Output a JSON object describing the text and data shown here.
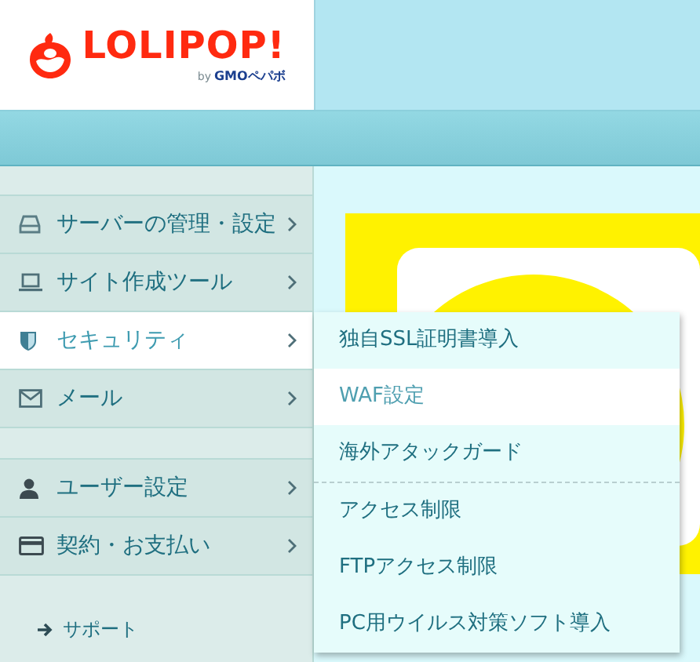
{
  "logo": {
    "wordmark": "LOLIPOP!",
    "byline_prefix": "by",
    "byline_brand": "GMOペパボ"
  },
  "sidebar": {
    "groups": [
      [
        {
          "label": "サーバーの管理・設定",
          "kind": "drive",
          "selected": false
        },
        {
          "label": "サイト作成ツール",
          "kind": "laptop",
          "selected": false
        },
        {
          "label": "セキュリティ",
          "kind": "shield",
          "selected": true
        },
        {
          "label": "メール",
          "kind": "envelope",
          "selected": false
        }
      ],
      [
        {
          "label": "ユーザー設定",
          "kind": "user",
          "selected": false
        },
        {
          "label": "契約・お支払い",
          "kind": "card",
          "selected": false
        }
      ]
    ],
    "support_link": "サポート"
  },
  "submenu": {
    "groups": [
      [
        {
          "label": "独自SSL証明書導入",
          "selected": false
        },
        {
          "label": "WAF設定",
          "selected": true
        },
        {
          "label": "海外アタックガード",
          "selected": false
        }
      ],
      [
        {
          "label": "アクセス制限",
          "selected": false
        },
        {
          "label": "FTPアクセス制限",
          "selected": false
        },
        {
          "label": "PC用ウイルス対策ソフト導入",
          "selected": false
        }
      ]
    ]
  }
}
